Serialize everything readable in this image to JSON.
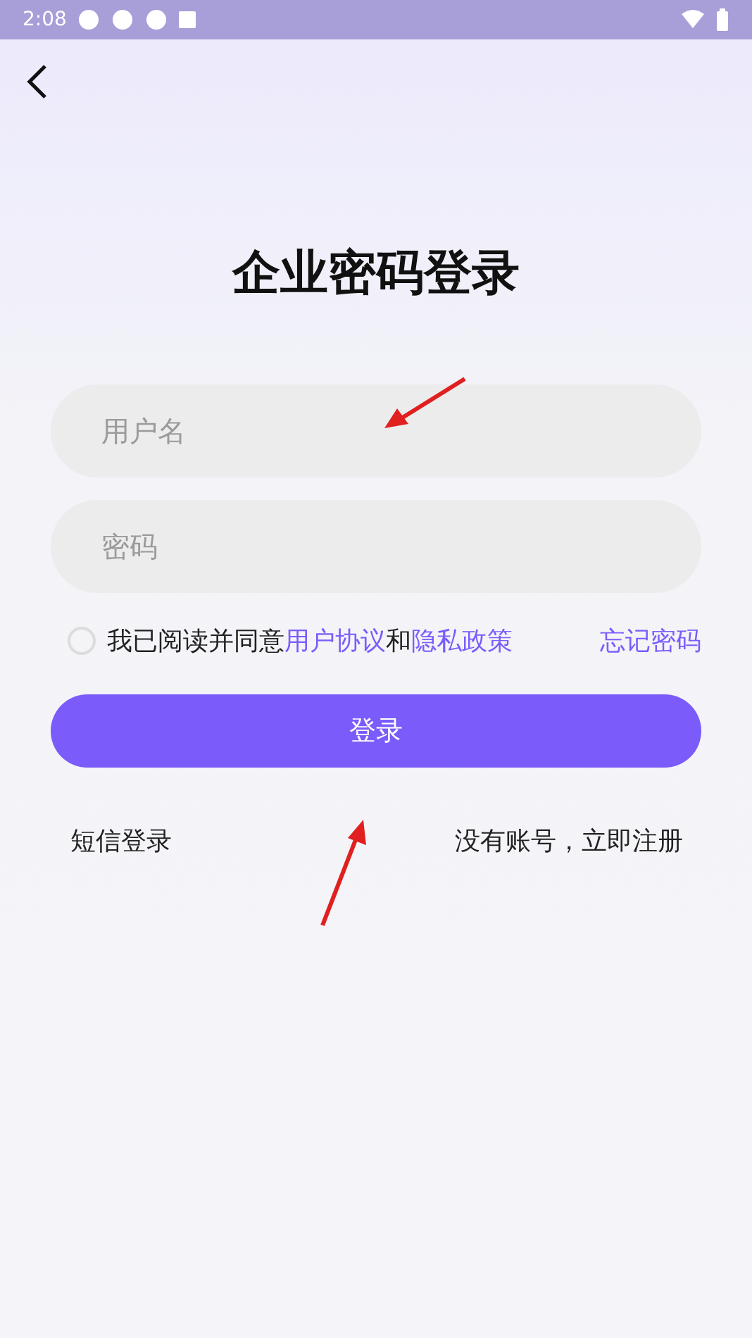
{
  "status_bar": {
    "time": "2:08"
  },
  "title": "企业密码登录",
  "fields": [
    {
      "placeholder": "用户名"
    },
    {
      "placeholder": "密码"
    }
  ],
  "agreement": {
    "checked": false,
    "text_before": "我已阅读并同意",
    "link_1": "用户协议",
    "joiner": "和",
    "link_2": "隐私政策"
  },
  "forgot_password": "忘记密码",
  "login_button": "登录",
  "bottom_links": [
    "短信登录",
    "没有账号，立即注册"
  ]
}
